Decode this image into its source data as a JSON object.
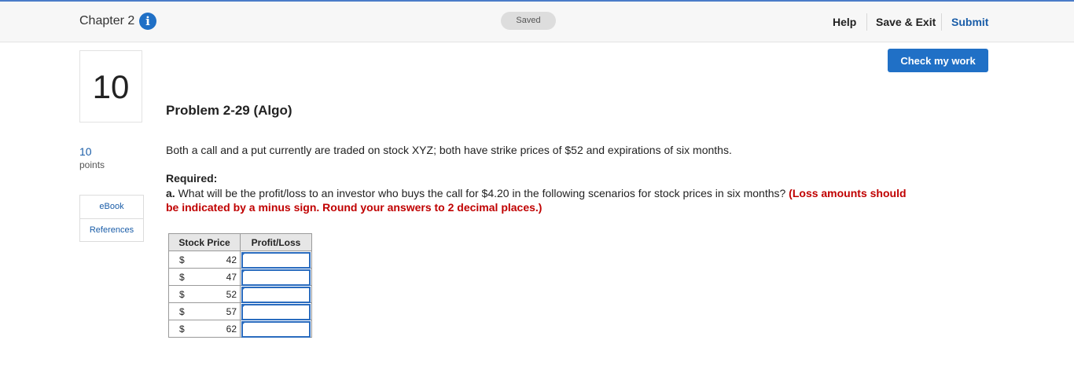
{
  "header": {
    "chapter_title": "Chapter 2",
    "info_icon": "i",
    "status": "Saved",
    "help_label": "Help",
    "save_exit_label": "Save & Exit",
    "submit_label": "Submit"
  },
  "actions": {
    "check_label": "Check my work"
  },
  "question": {
    "number": "10",
    "points_value": "10",
    "points_label": "points",
    "resources": {
      "ebook": "eBook",
      "references": "References"
    },
    "title": "Problem 2-29 (Algo)",
    "text": "Both a call and a put currently are traded on stock XYZ; both have strike prices of $52 and expirations of six months.",
    "required_heading": "Required:",
    "part_a_label": "a.",
    "part_a_text": " What will be the profit/loss to an investor who buys the call for $4.20 in the following scenarios for stock prices in six months? ",
    "part_a_instructions": "(Loss amounts should be indicated by a minus sign. Round your answers to 2 decimal places.)"
  },
  "table": {
    "headers": [
      "Stock Price",
      "Profit/Loss"
    ],
    "currency": "$",
    "rows": [
      {
        "price": "42",
        "answer": ""
      },
      {
        "price": "47",
        "answer": ""
      },
      {
        "price": "52",
        "answer": ""
      },
      {
        "price": "57",
        "answer": ""
      },
      {
        "price": "62",
        "answer": ""
      }
    ]
  },
  "colors": {
    "accent": "#2070c6",
    "link": "#1a5da8",
    "instructions": "#c00000",
    "input_border": "#2a6cbf"
  },
  "icons": [
    "info-icon"
  ]
}
